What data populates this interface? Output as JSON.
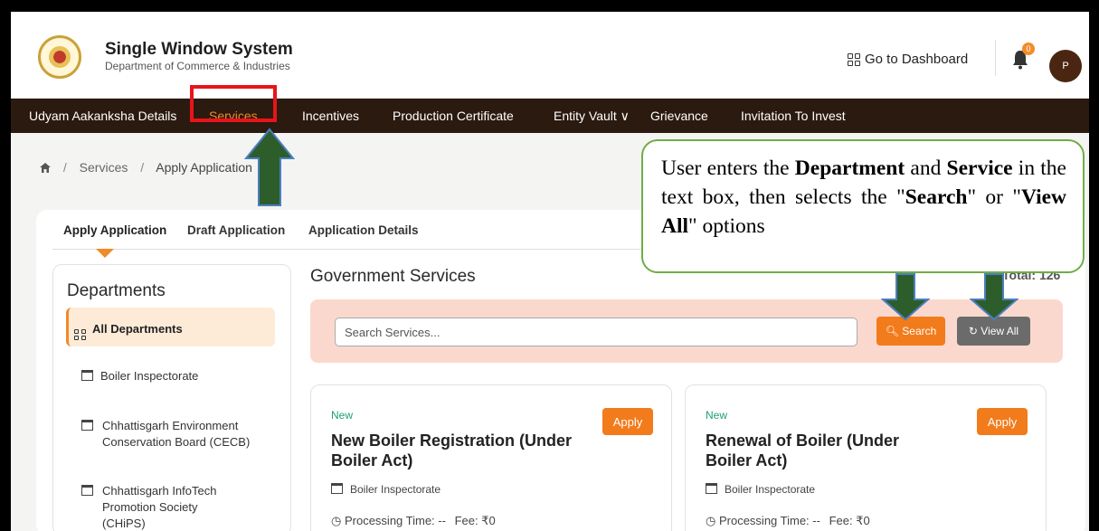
{
  "header": {
    "title": "Single Window System",
    "subtitle": "Department of Commerce & Industries",
    "dashboard_label": "Go to Dashboard",
    "notification_count": "0",
    "avatar_initial": "P"
  },
  "nav": {
    "items": [
      {
        "label": "Udyam Aakanksha Details"
      },
      {
        "label": "Services"
      },
      {
        "label": "Incentives"
      },
      {
        "label": "Production Certificate"
      },
      {
        "label": "Entity Vault ∨"
      },
      {
        "label": "Grievance"
      },
      {
        "label": "Invitation To Invest"
      }
    ],
    "active": "Services"
  },
  "breadcrumb": {
    "home_icon": "home-icon",
    "items": [
      "Services",
      "Apply Application"
    ],
    "separator": "/"
  },
  "tabs": [
    {
      "label": "Apply Application"
    },
    {
      "label": "Draft Application"
    },
    {
      "label": "Application Details"
    }
  ],
  "departments": {
    "title": "Departments",
    "all_label": "All Departments",
    "items": [
      {
        "label": "Boiler Inspectorate"
      },
      {
        "label": "Chhattisgarh Environment Conservation Board (CECB)"
      },
      {
        "label": "Chhattisgarh InfoTech Promotion Society (CHiPS)"
      }
    ]
  },
  "main": {
    "title": "Government Services",
    "total": "Total: 126",
    "search_placeholder": "Search Services...",
    "search_button": "Search",
    "view_all_button": "View All"
  },
  "services": [
    {
      "badge": "New",
      "name": "New Boiler Registration (Under Boiler Act)",
      "department": "Boiler Inspectorate",
      "processing": "Processing Time: --",
      "fee": "Fee: ₹0",
      "apply_label": "Apply"
    },
    {
      "badge": "New",
      "name": "Renewal of Boiler (Under Boiler Act)",
      "department": "Boiler Inspectorate",
      "processing": "Processing Time: --",
      "fee": "Fee: ₹0",
      "apply_label": "Apply"
    }
  ],
  "annotation": {
    "p1": "User enters the ",
    "b1": "Department",
    "p2": " and ",
    "b2": "Service",
    "p3": " in the text box, then selects the \"",
    "b3": "Search",
    "p4": "\" or \"",
    "b4": "View All",
    "p5": "\" options"
  },
  "colors": {
    "nav_bg": "#2b1a0f",
    "accent": "#f27b1c",
    "highlight_box": "#e8141b",
    "callout_border": "#70ad47",
    "arrow_fill": "#2e5d2c"
  }
}
